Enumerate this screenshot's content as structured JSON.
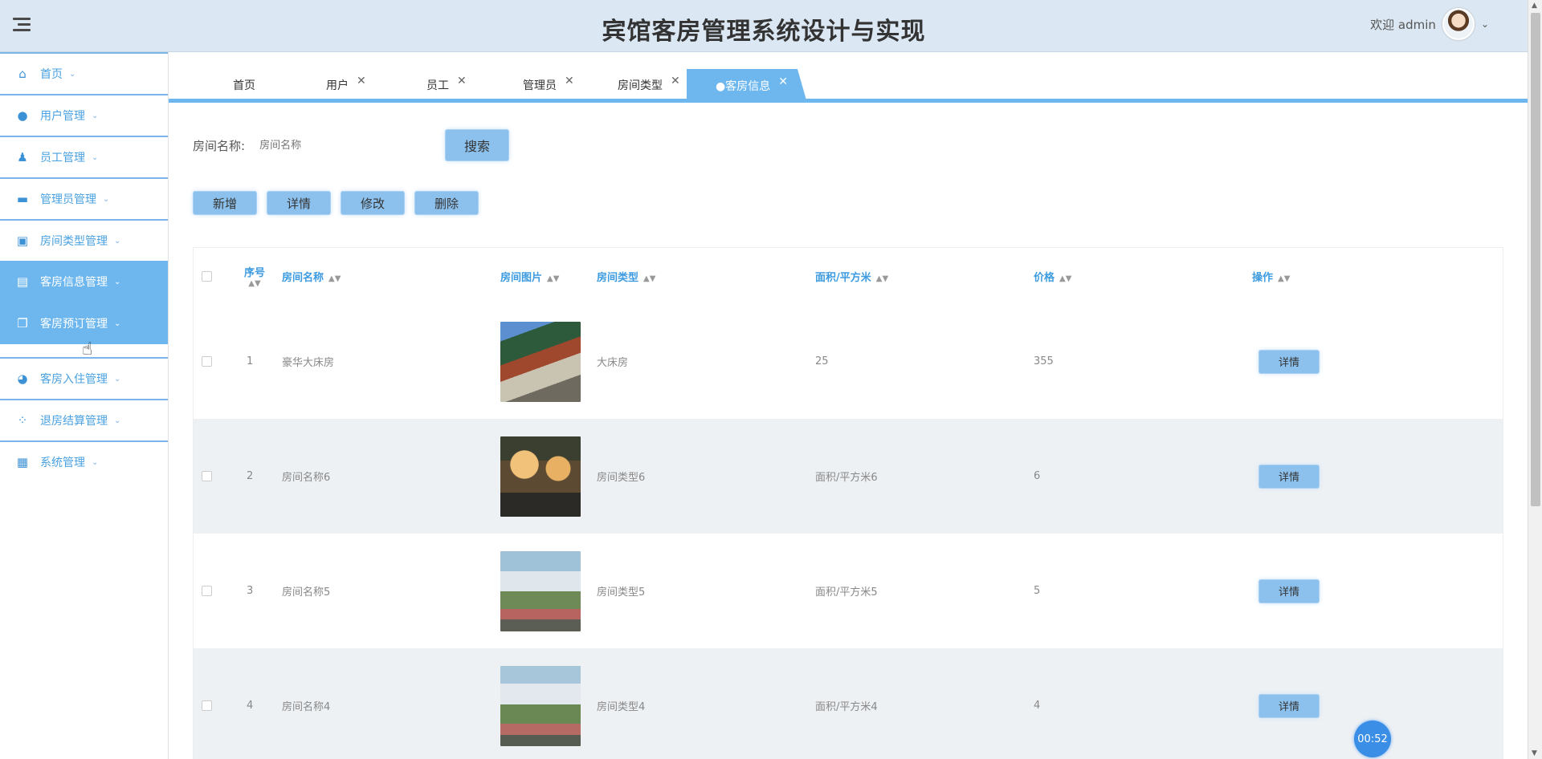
{
  "header": {
    "title": "宾馆客房管理系统设计与实现",
    "welcome": "欢迎 admin"
  },
  "sidebar": {
    "items": [
      {
        "label": "首页",
        "icon": "home-icon"
      },
      {
        "label": "用户管理",
        "icon": "user-icon"
      },
      {
        "label": "员工管理",
        "icon": "person-icon"
      },
      {
        "label": "管理员管理",
        "icon": "store-icon"
      },
      {
        "label": "房间类型管理",
        "icon": "briefcase-icon"
      },
      {
        "label": "客房信息管理",
        "icon": "archive-icon"
      },
      {
        "label": "客房预订管理",
        "icon": "copy-icon"
      },
      {
        "label": "客房入住管理",
        "icon": "pie-icon"
      },
      {
        "label": "退房结算管理",
        "icon": "apps-icon"
      },
      {
        "label": "系统管理",
        "icon": "grid-icon"
      }
    ]
  },
  "tabs": [
    {
      "label": "首页"
    },
    {
      "label": "用户"
    },
    {
      "label": "员工"
    },
    {
      "label": "管理员"
    },
    {
      "label": "房间类型"
    },
    {
      "label": "●客房信息"
    }
  ],
  "search": {
    "label": "房间名称:",
    "placeholder": "房间名称",
    "button": "搜索"
  },
  "actions": {
    "add": "新增",
    "detail": "详情",
    "edit": "修改",
    "delete": "删除"
  },
  "table": {
    "columns": [
      "序号",
      "房间名称",
      "房间图片",
      "房间类型",
      "面积/平方米",
      "价格",
      "操作"
    ],
    "rows": [
      {
        "idx": "1",
        "name": "豪华大床房",
        "type": "大床房",
        "area": "25",
        "price": "355",
        "op": "详情"
      },
      {
        "idx": "2",
        "name": "房间名称6",
        "type": "房间类型6",
        "area": "面积/平方米6",
        "price": "6",
        "op": "详情"
      },
      {
        "idx": "3",
        "name": "房间名称5",
        "type": "房间类型5",
        "area": "面积/平方米5",
        "price": "5",
        "op": "详情"
      },
      {
        "idx": "4",
        "name": "房间名称4",
        "type": "房间类型4",
        "area": "面积/平方米4",
        "price": "4",
        "op": "详情"
      }
    ]
  },
  "timer": "00:52",
  "colors": {
    "accent": "#6db7ee",
    "header_bg": "#dbe7f3",
    "link": "#3d9be0"
  }
}
